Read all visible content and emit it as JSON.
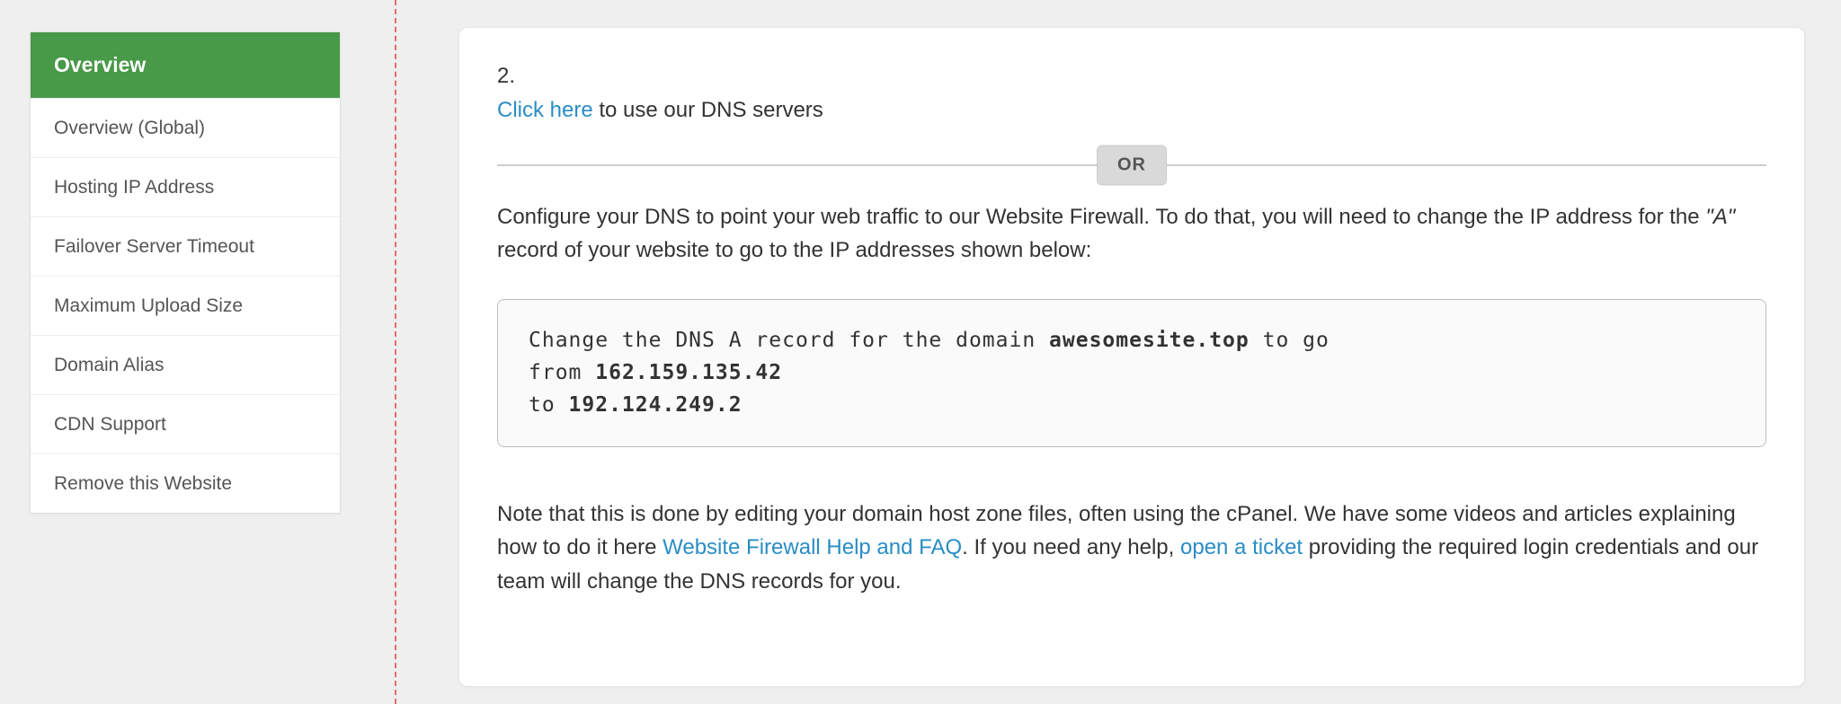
{
  "sidebar": {
    "items": [
      {
        "label": "Overview",
        "active": true
      },
      {
        "label": "Overview (Global)"
      },
      {
        "label": "Hosting IP Address"
      },
      {
        "label": "Failover Server Timeout"
      },
      {
        "label": "Maximum Upload Size"
      },
      {
        "label": "Domain Alias"
      },
      {
        "label": "CDN Support"
      },
      {
        "label": "Remove this Website"
      }
    ]
  },
  "main": {
    "step_number": "2.",
    "click_here": "Click here",
    "click_rest": " to use our DNS servers",
    "or_label": "OR",
    "para1_a": "Configure your DNS to point your web traffic to our Website Firewall. To do that, you will need to change the IP address for the ",
    "para1_i": "\"A\"",
    "para1_b": " record of your website to go to the IP addresses shown below:",
    "code": {
      "l1a": "Change the DNS A record for the domain ",
      "domain": "awesomesite.top",
      "l1b": " to go",
      "l2a": "from ",
      "from_ip": "162.159.135.42",
      "l3a": "to ",
      "to_ip": "192.124.249.2"
    },
    "note_a": "Note that this is done by editing your domain host zone files, often using the cPanel. We have some videos and articles explaining how to do it here ",
    "link_help": "Website Firewall Help and FAQ",
    "note_b": ". If you need any help, ",
    "link_ticket": "open a ticket",
    "note_c": " providing the required login credentials and our team will change the DNS records for you."
  },
  "colors": {
    "accent_green": "#489948",
    "link": "#2a8dc5",
    "dashed": "#e46b6f",
    "arrow": "#5b43e0"
  }
}
